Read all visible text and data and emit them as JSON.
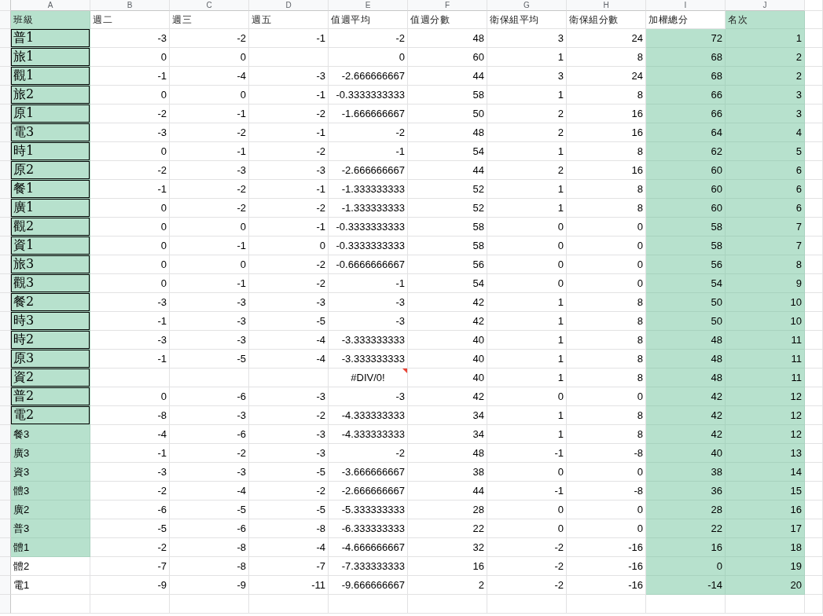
{
  "columns": [
    {
      "letter": "A",
      "header": "班級",
      "header_highlighted": true
    },
    {
      "letter": "B",
      "header": "週二",
      "header_highlighted": false,
      "highlighted": false
    },
    {
      "letter": "C",
      "header": "週三",
      "header_highlighted": false,
      "highlighted": false
    },
    {
      "letter": "D",
      "header": "週五",
      "header_highlighted": false,
      "highlighted": false
    },
    {
      "letter": "E",
      "header": "值週平均",
      "header_highlighted": false,
      "highlighted": false
    },
    {
      "letter": "F",
      "header": "值週分數",
      "header_highlighted": false,
      "highlighted": false
    },
    {
      "letter": "G",
      "header": "衛保組平均",
      "header_highlighted": false,
      "highlighted": false
    },
    {
      "letter": "H",
      "header": "衛保組分數",
      "header_highlighted": false,
      "highlighted": false
    },
    {
      "letter": "I",
      "header": "加權總分",
      "header_highlighted": false,
      "highlighted": true
    },
    {
      "letter": "J",
      "header": "名次",
      "header_highlighted": true,
      "highlighted": true
    }
  ],
  "rows": [
    {
      "label": "普1",
      "highlighted": true,
      "bordered": true,
      "cells": [
        "-3",
        "-2",
        "-1",
        "-2",
        "48",
        "3",
        "24",
        "72",
        "1"
      ]
    },
    {
      "label": "旅1",
      "highlighted": true,
      "bordered": true,
      "cells": [
        "0",
        "0",
        "",
        "0",
        "60",
        "1",
        "8",
        "68",
        "2"
      ]
    },
    {
      "label": "觀1",
      "highlighted": true,
      "bordered": true,
      "cells": [
        "-1",
        "-4",
        "-3",
        "-2.666666667",
        "44",
        "3",
        "24",
        "68",
        "2"
      ]
    },
    {
      "label": "旅2",
      "highlighted": true,
      "bordered": true,
      "cells": [
        "0",
        "0",
        "-1",
        "-0.3333333333",
        "58",
        "1",
        "8",
        "66",
        "3"
      ]
    },
    {
      "label": "原1",
      "highlighted": true,
      "bordered": true,
      "cells": [
        "-2",
        "-1",
        "-2",
        "-1.666666667",
        "50",
        "2",
        "16",
        "66",
        "3"
      ]
    },
    {
      "label": "電3",
      "highlighted": true,
      "bordered": true,
      "cells": [
        "-3",
        "-2",
        "-1",
        "-2",
        "48",
        "2",
        "16",
        "64",
        "4"
      ]
    },
    {
      "label": "時1",
      "highlighted": true,
      "bordered": true,
      "cells": [
        "0",
        "-1",
        "-2",
        "-1",
        "54",
        "1",
        "8",
        "62",
        "5"
      ]
    },
    {
      "label": "原2",
      "highlighted": true,
      "bordered": true,
      "cells": [
        "-2",
        "-3",
        "-3",
        "-2.666666667",
        "44",
        "2",
        "16",
        "60",
        "6"
      ]
    },
    {
      "label": "餐1",
      "highlighted": true,
      "bordered": true,
      "cells": [
        "-1",
        "-2",
        "-1",
        "-1.333333333",
        "52",
        "1",
        "8",
        "60",
        "6"
      ]
    },
    {
      "label": "廣1",
      "highlighted": true,
      "bordered": true,
      "cells": [
        "0",
        "-2",
        "-2",
        "-1.333333333",
        "52",
        "1",
        "8",
        "60",
        "6"
      ]
    },
    {
      "label": "觀2",
      "highlighted": true,
      "bordered": true,
      "cells": [
        "0",
        "0",
        "-1",
        "-0.3333333333",
        "58",
        "0",
        "0",
        "58",
        "7"
      ]
    },
    {
      "label": "資1",
      "highlighted": true,
      "bordered": true,
      "cells": [
        "0",
        "-1",
        "0",
        "-0.3333333333",
        "58",
        "0",
        "0",
        "58",
        "7"
      ]
    },
    {
      "label": "旅3",
      "highlighted": true,
      "bordered": true,
      "cells": [
        "0",
        "0",
        "-2",
        "-0.6666666667",
        "56",
        "0",
        "0",
        "56",
        "8"
      ]
    },
    {
      "label": "觀3",
      "highlighted": true,
      "bordered": true,
      "cells": [
        "0",
        "-1",
        "-2",
        "-1",
        "54",
        "0",
        "0",
        "54",
        "9"
      ]
    },
    {
      "label": "餐2",
      "highlighted": true,
      "bordered": true,
      "cells": [
        "-3",
        "-3",
        "-3",
        "-3",
        "42",
        "1",
        "8",
        "50",
        "10"
      ]
    },
    {
      "label": "時3",
      "highlighted": true,
      "bordered": true,
      "cells": [
        "-1",
        "-3",
        "-5",
        "-3",
        "42",
        "1",
        "8",
        "50",
        "10"
      ]
    },
    {
      "label": "時2",
      "highlighted": true,
      "bordered": true,
      "cells": [
        "-3",
        "-3",
        "-4",
        "-3.333333333",
        "40",
        "1",
        "8",
        "48",
        "11"
      ]
    },
    {
      "label": "原3",
      "highlighted": true,
      "bordered": true,
      "cells": [
        "-1",
        "-5",
        "-4",
        "-3.333333333",
        "40",
        "1",
        "8",
        "48",
        "11"
      ]
    },
    {
      "label": "資2",
      "highlighted": true,
      "bordered": true,
      "cells": [
        "",
        "",
        "",
        {
          "text": "#DIV/0!",
          "kind": "error"
        },
        "40",
        "1",
        "8",
        "48",
        "11"
      ]
    },
    {
      "label": "普2",
      "highlighted": true,
      "bordered": true,
      "cells": [
        "0",
        "-6",
        "-3",
        "-3",
        "42",
        "0",
        "0",
        "42",
        "12"
      ]
    },
    {
      "label": "電2",
      "highlighted": true,
      "bordered": true,
      "cells": [
        "-8",
        "-3",
        "-2",
        "-4.333333333",
        "34",
        "1",
        "8",
        "42",
        "12"
      ]
    },
    {
      "label": "餐3",
      "highlighted": true,
      "bordered": false,
      "cells": [
        "-4",
        "-6",
        "-3",
        "-4.333333333",
        "34",
        "1",
        "8",
        "42",
        "12"
      ]
    },
    {
      "label": "廣3",
      "highlighted": true,
      "bordered": false,
      "cells": [
        "-1",
        "-2",
        "-3",
        "-2",
        "48",
        "-1",
        "-8",
        "40",
        "13"
      ]
    },
    {
      "label": "資3",
      "highlighted": true,
      "bordered": false,
      "cells": [
        "-3",
        "-3",
        "-5",
        "-3.666666667",
        "38",
        "0",
        "0",
        "38",
        "14"
      ]
    },
    {
      "label": "體3",
      "highlighted": true,
      "bordered": false,
      "cells": [
        "-2",
        "-4",
        "-2",
        "-2.666666667",
        "44",
        "-1",
        "-8",
        "36",
        "15"
      ]
    },
    {
      "label": "廣2",
      "highlighted": true,
      "bordered": false,
      "cells": [
        "-6",
        "-5",
        "-5",
        "-5.333333333",
        "28",
        "0",
        "0",
        "28",
        "16"
      ]
    },
    {
      "label": "普3",
      "highlighted": true,
      "bordered": false,
      "cells": [
        "-5",
        "-6",
        "-8",
        "-6.333333333",
        "22",
        "0",
        "0",
        "22",
        "17"
      ]
    },
    {
      "label": "體1",
      "highlighted": true,
      "bordered": false,
      "cells": [
        "-2",
        "-8",
        "-4",
        "-4.666666667",
        "32",
        "-2",
        "-16",
        "16",
        "18"
      ]
    },
    {
      "label": "體2",
      "highlighted": false,
      "bordered": false,
      "cells": [
        "-7",
        "-8",
        "-7",
        "-7.333333333",
        "16",
        "-2",
        "-16",
        "0",
        "19"
      ]
    },
    {
      "label": "電1",
      "highlighted": false,
      "bordered": false,
      "cells": [
        "-9",
        "-9",
        "-11",
        "-9.666666667",
        "2",
        "-2",
        "-16",
        "-14",
        "20"
      ]
    }
  ]
}
